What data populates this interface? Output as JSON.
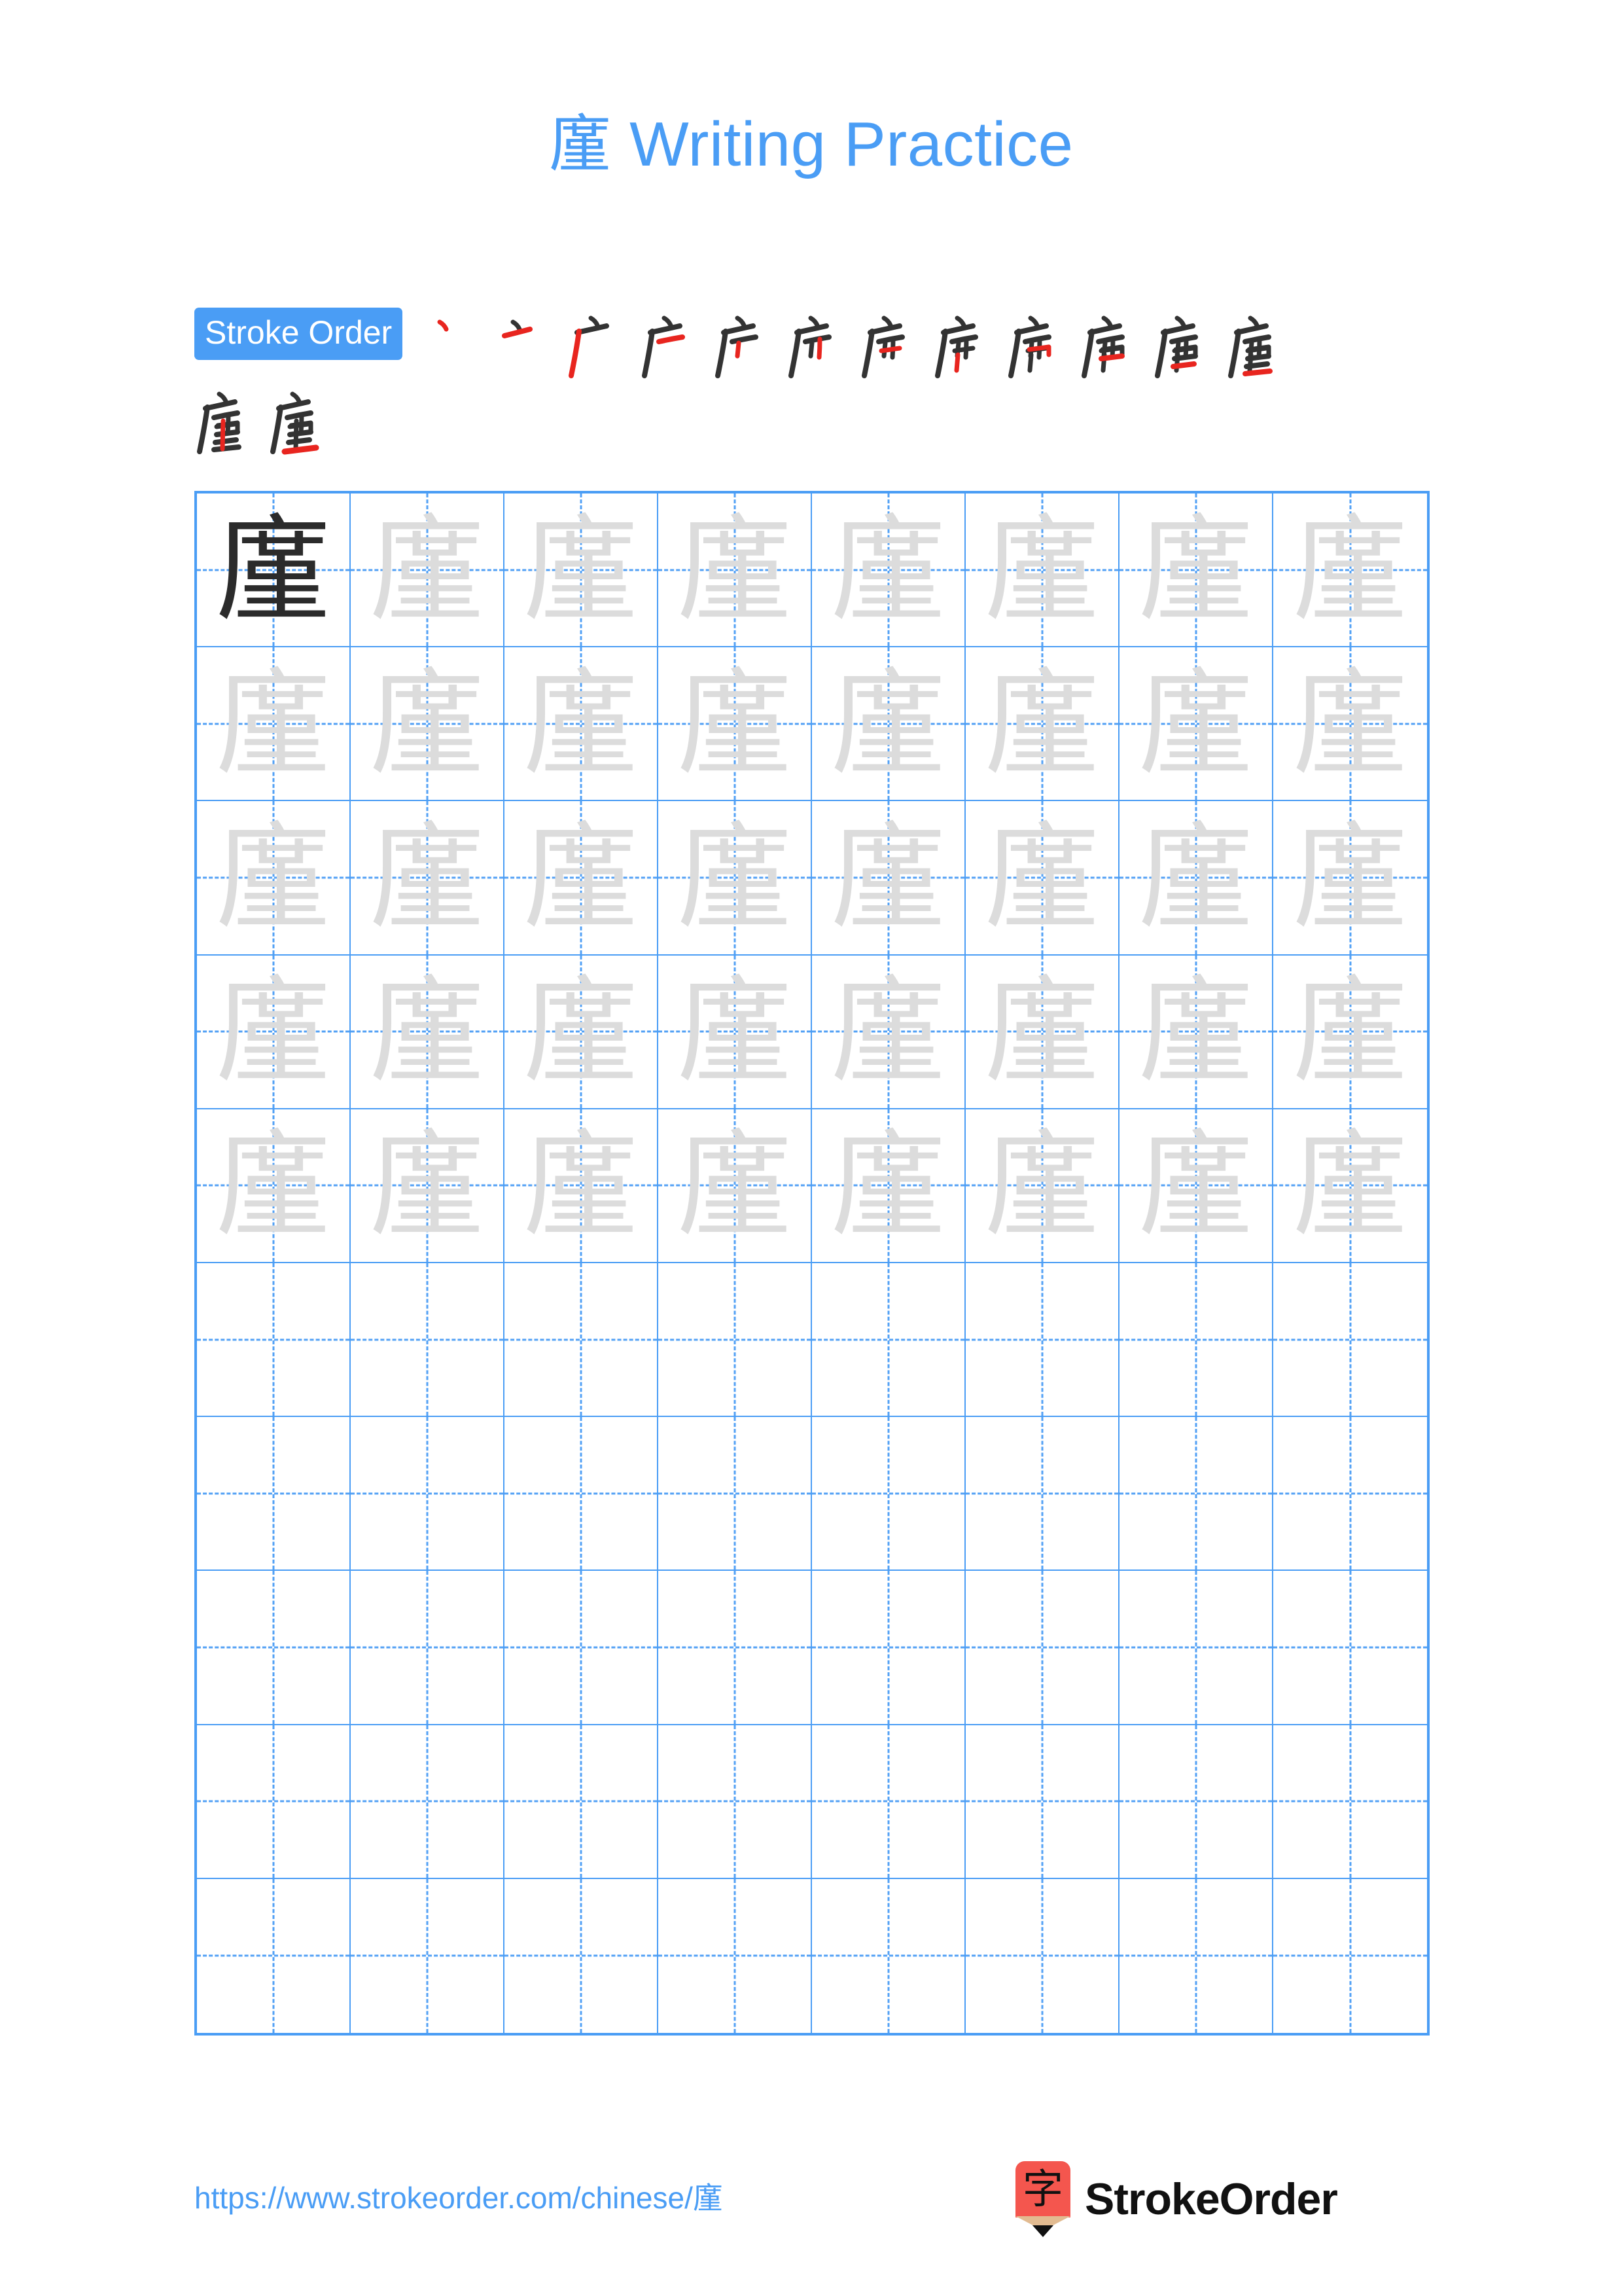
{
  "character": "廑",
  "header": {
    "title": "廑 Writing Practice"
  },
  "stroke_order": {
    "badge_label": "Stroke Order",
    "total_strokes": 14,
    "steps": [
      {
        "index": 1,
        "glyph": "丶",
        "new_stroke": "dot"
      },
      {
        "index": 2,
        "glyph": "亠",
        "new_stroke": "horizontal"
      },
      {
        "index": 3,
        "glyph": "广",
        "new_stroke": "left-falling"
      },
      {
        "index": 4,
        "glyph": "产",
        "new_stroke": "horizontal"
      },
      {
        "index": 5,
        "glyph": "产",
        "new_stroke": "short-vertical"
      },
      {
        "index": 6,
        "glyph": "庐",
        "new_stroke": "vertical"
      },
      {
        "index": 7,
        "glyph": "庐",
        "new_stroke": "horizontal"
      },
      {
        "index": 8,
        "glyph": "庑",
        "new_stroke": "vertical"
      },
      {
        "index": 9,
        "glyph": "庤",
        "new_stroke": "horizontal-hook"
      },
      {
        "index": 10,
        "glyph": "庿",
        "new_stroke": "horizontal"
      },
      {
        "index": 11,
        "glyph": "廇",
        "new_stroke": "horizontal"
      },
      {
        "index": 12,
        "glyph": "廦",
        "new_stroke": "horizontal"
      },
      {
        "index": 13,
        "glyph": "廑",
        "new_stroke": "vertical"
      },
      {
        "index": 14,
        "glyph": "廑",
        "new_stroke": "bottom-horizontal"
      }
    ]
  },
  "practice_grid": {
    "columns": 8,
    "rows": 10,
    "filled_rows": 5,
    "model_cell": {
      "row": 1,
      "column": 1,
      "style": "dark"
    },
    "trace_style": "light",
    "grid_line_color": "#4a9df5",
    "model_char_color": "#2b2b2b",
    "trace_char_color": "#dcdcdc"
  },
  "footer": {
    "url": "https://www.strokeorder.com/chinese/廑",
    "brand_name": "StrokeOrder",
    "logo_char": "字",
    "logo_color": "#f4564e"
  },
  "colors": {
    "accent_blue": "#4a9df5",
    "stroke_new": "#e8251f",
    "stroke_old": "#333333"
  }
}
